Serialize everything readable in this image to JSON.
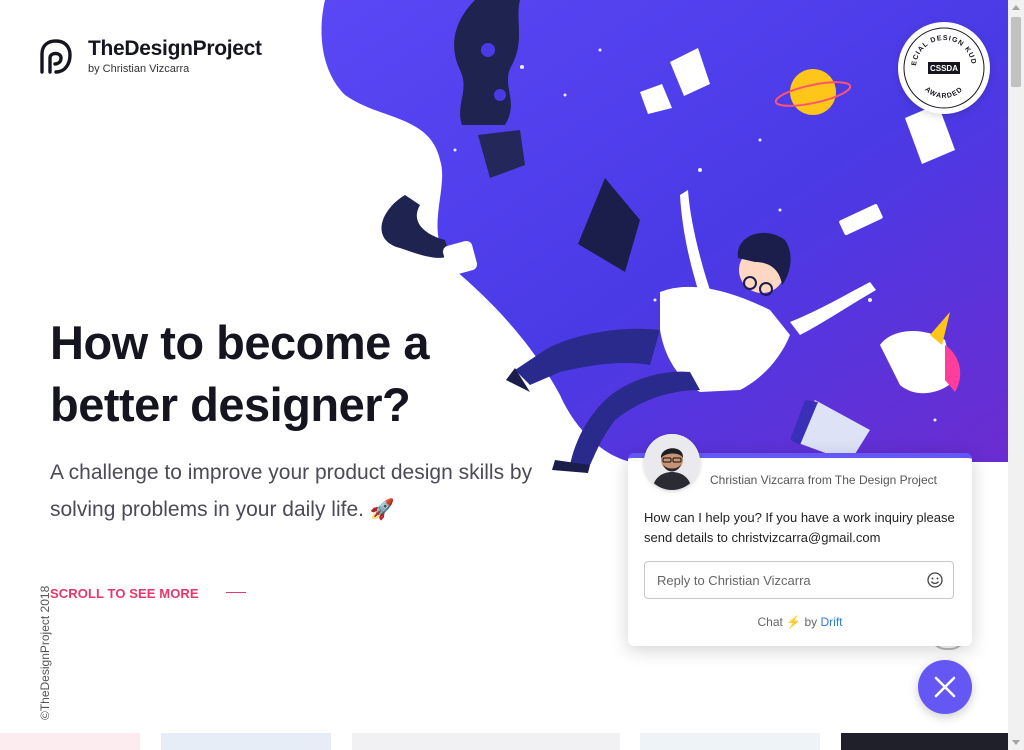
{
  "brand": {
    "name": "TheDesignProject",
    "byline": "by Christian Vizcarra"
  },
  "award": {
    "top_text": "SPECIAL DESIGN KUDOS",
    "center": "CSSDA",
    "bottom_text": "AWARDED"
  },
  "hero": {
    "title": "How to become a better designer?",
    "subtitle": "A challenge to improve your product design skills by solving problems in your daily life.",
    "subtitle_emoji": "🚀",
    "scroll_cta": "SCROLL TO SEE MORE"
  },
  "copyright": "©TheDesignProject 2018",
  "colors": {
    "accent": "#e8366b",
    "chat_brand": "#6557f4",
    "hero_blob": "#4b3ee8"
  },
  "chat": {
    "sender": "Christian Vizcarra from The Design Project",
    "message": "How can I help you? If you have a work inquiry please send details to christvizcarra@gmail.com",
    "reply_placeholder": "Reply to Christian Vizcarra",
    "footer_chat": "Chat",
    "footer_by": "by",
    "footer_brand": "Drift",
    "emoji_icon": "smiley-icon",
    "close_icon": "close-icon"
  },
  "thumbnails": [
    {
      "color": "#fdecef"
    },
    {
      "color": "#e7edf7"
    },
    {
      "color": "#f1f1f4"
    },
    {
      "color": "#eef3f8"
    },
    {
      "color": "#20202a"
    }
  ]
}
